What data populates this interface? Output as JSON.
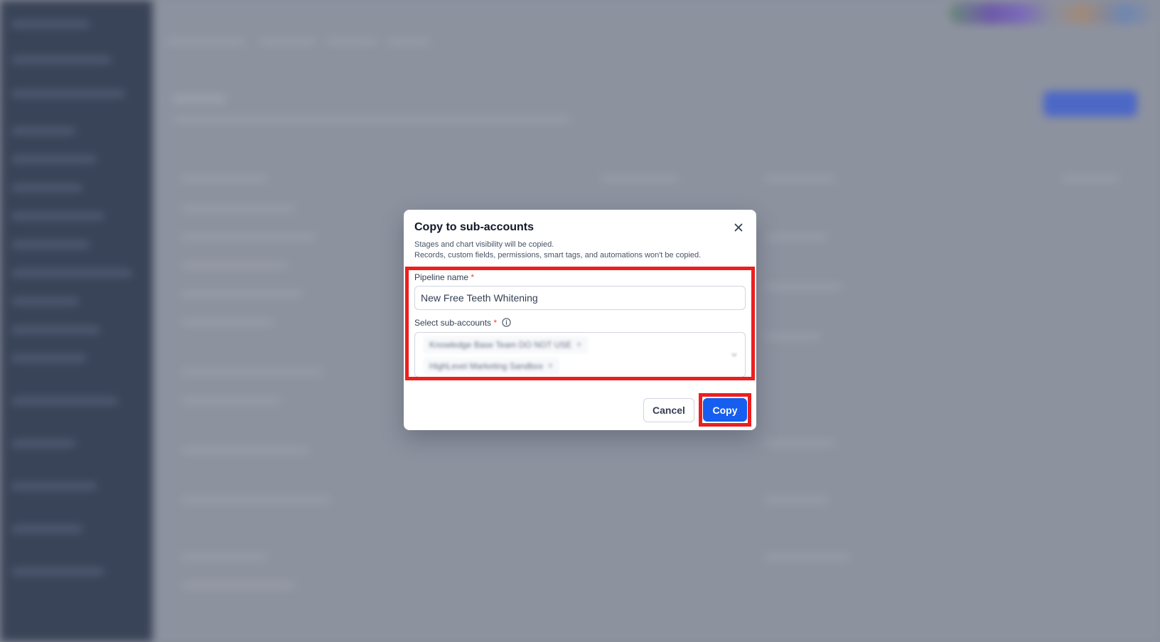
{
  "modal": {
    "title": "Copy to sub-accounts",
    "description_line1": "Stages and chart visibility will be copied.",
    "description_line2": "Records, custom fields, permissions, smart tags, and automations won't be copied.",
    "pipeline_name_label": "Pipeline name",
    "pipeline_name_value": "New Free Teeth Whitening",
    "required_marker": "*",
    "sub_accounts_label": "Select sub-accounts",
    "selected_sub_accounts": [
      {
        "label": "Knowledge Base Team DO NOT USE"
      },
      {
        "label": "HighLevel Marketing Sandbox"
      }
    ],
    "cancel_label": "Cancel",
    "copy_label": "Copy"
  },
  "icons": {
    "close": "close-icon",
    "info": "info-icon",
    "chip_remove": "x-icon",
    "dropdown": "chevron-down-icon"
  },
  "colors": {
    "primary": "#155eef",
    "highlight": "#ec1f1f",
    "required": "#f04438",
    "overlay": "#8a8f9c"
  }
}
